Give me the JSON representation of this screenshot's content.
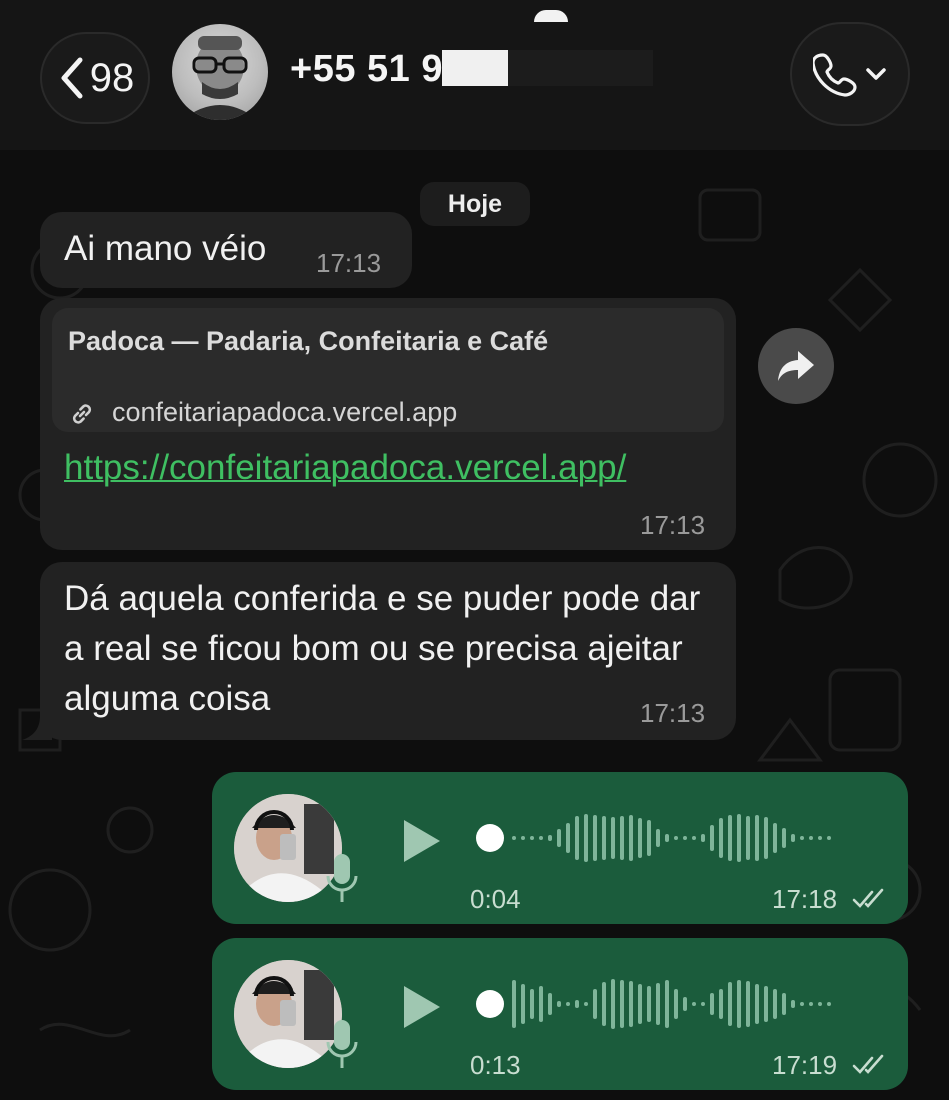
{
  "header": {
    "back_count": "98",
    "contact_name": "+55 51 9"
  },
  "chat": {
    "date_label": "Hoje",
    "messages": [
      {
        "text": "Ai mano véio",
        "time": "17:13"
      },
      {
        "preview_title": "Padoca — Padaria, Confeitaria e Café",
        "preview_domain": "confeitariapadoca.vercel.app",
        "link": "https://confeitariapadoca.vercel.app/",
        "time": "17:13"
      },
      {
        "text": "Dá aquela conferida e se puder pode dar a real se ficou bom ou se precisa ajeitar alguma coisa",
        "time": "17:13"
      }
    ],
    "voice_notes": [
      {
        "duration": "0:04",
        "time": "17:18"
      },
      {
        "duration": "0:13",
        "time": "17:19"
      }
    ]
  },
  "colors": {
    "outgoing_bubble": "#1b5c3c",
    "incoming_bubble": "#222222",
    "link": "#3fbf62"
  },
  "icons": [
    "chevron-left-icon",
    "phone-icon",
    "chevron-down-icon",
    "link-icon",
    "forward-icon",
    "play-icon",
    "mic-icon",
    "double-check-icon"
  ]
}
